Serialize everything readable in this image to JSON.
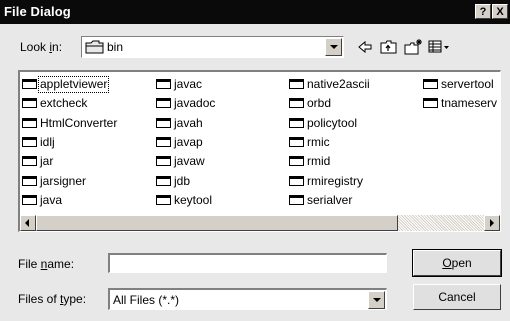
{
  "titlebar": {
    "title": "File Dialog",
    "help_label": "?",
    "close_label": "X"
  },
  "toolbar": {
    "lookin_prefix": "Look ",
    "lookin_accel": "i",
    "lookin_suffix": "n:",
    "current_folder": "bin",
    "icons": [
      "back-arrow-icon",
      "up-folder-icon",
      "new-folder-icon",
      "view-menu-icon"
    ]
  },
  "files": {
    "col1": [
      "appletviewer",
      "extcheck",
      "HtmlConverter",
      "idlj",
      "jar",
      "jarsigner",
      "java"
    ],
    "col2": [
      "javac",
      "javadoc",
      "javah",
      "javap",
      "javaw",
      "jdb",
      "keytool"
    ],
    "col3": [
      "native2ascii",
      "orbd",
      "policytool",
      "rmic",
      "rmid",
      "rmiregistry",
      "serialver"
    ],
    "col4": [
      "servertool",
      "tnameserv"
    ],
    "selected": "appletviewer"
  },
  "form": {
    "filename_prefix": "File ",
    "filename_accel": "n",
    "filename_suffix": "ame:",
    "filename_value": "",
    "filetype_prefix": "Files of ",
    "filetype_accel": "t",
    "filetype_suffix": "ype:",
    "filetype_value": "All Files (*.*)"
  },
  "buttons": {
    "open_accel": "O",
    "open_rest": "pen",
    "cancel_label": "Cancel"
  }
}
